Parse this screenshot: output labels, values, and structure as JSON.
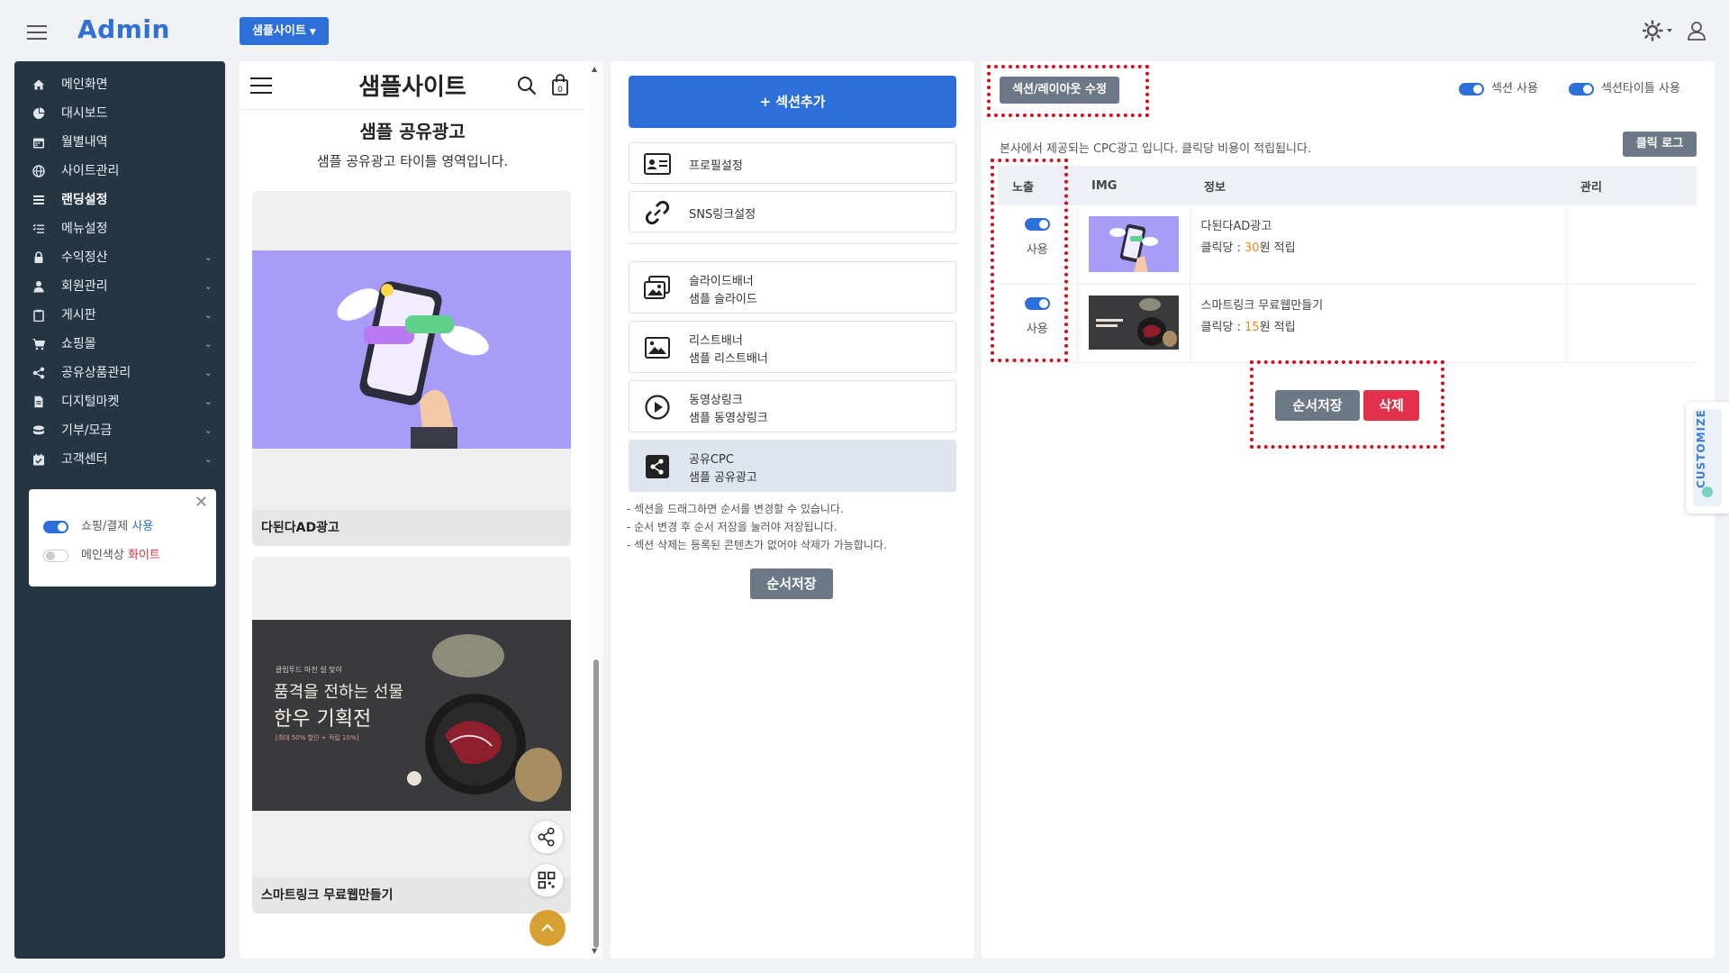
{
  "header": {
    "logo": "Admin",
    "site_dropdown": "샘플사이트",
    "icons": [
      "hamburger-icon",
      "theme-sun-icon",
      "user-icon"
    ]
  },
  "sidebar": {
    "items": [
      {
        "label": "메인화면",
        "icon": "home-icon"
      },
      {
        "label": "대시보드",
        "icon": "pie-chart-icon"
      },
      {
        "label": "월별내역",
        "icon": "calendar-icon"
      },
      {
        "label": "사이트관리",
        "icon": "globe-icon"
      },
      {
        "label": "랜딩설정",
        "icon": "list-icon",
        "active": true
      },
      {
        "label": "메뉴설정",
        "icon": "list-check-icon"
      },
      {
        "label": "수익정산",
        "icon": "lock-icon",
        "expandable": true
      },
      {
        "label": "회원관리",
        "icon": "person-icon",
        "expandable": true
      },
      {
        "label": "게시판",
        "icon": "clipboard-icon",
        "expandable": true
      },
      {
        "label": "쇼핑몰",
        "icon": "cart-icon",
        "expandable": true
      },
      {
        "label": "공유상품관리",
        "icon": "share-icon",
        "expandable": true
      },
      {
        "label": "디지털마켓",
        "icon": "file-icon",
        "expandable": true
      },
      {
        "label": "기부/모금",
        "icon": "coins-icon",
        "expandable": true
      },
      {
        "label": "고객센터",
        "icon": "calendar-check-icon",
        "expandable": true
      }
    ],
    "settings_card": {
      "row1_label": "쇼핑/결제 ",
      "row1_value": "사용",
      "row1_on": true,
      "row2_label": "메인색상 ",
      "row2_value": "화이트",
      "row2_on": false
    }
  },
  "preview": {
    "site_title": "샘플사이트",
    "section_title": "샘플 공유광고",
    "section_subtitle": "샘플 공유광고 타이틀 영역입니다.",
    "cards": [
      {
        "label": "다된다AD광고"
      },
      {
        "label": "스마트링크 무료웹만들기",
        "banner_small": "클립투드 마전 설 맞이",
        "banner_line1": "품격을 전하는 선물",
        "banner_line2": "한우 기획전",
        "banner_tag": "[최대 50% 할인 + 적립 10%]"
      }
    ]
  },
  "sections": {
    "add_button": "+ 섹션추가",
    "items": [
      {
        "line1": "프로필설정",
        "line2": "",
        "icon": "profile-card-icon"
      },
      {
        "line1": "SNS링크설정",
        "line2": "",
        "icon": "link-icon"
      },
      {
        "line1": "슬라이드배너",
        "line2": "샘플 슬라이드",
        "icon": "images-icon"
      },
      {
        "line1": "리스트배너",
        "line2": "샘플 리스트배너",
        "icon": "image-icon"
      },
      {
        "line1": "동영상링크",
        "line2": "샘플 동영상링크",
        "icon": "play-icon"
      },
      {
        "line1": "공유CPC",
        "line2": "샘플 공유광고",
        "icon": "share-square-icon",
        "active": true
      }
    ],
    "notes": [
      "- 섹션을 드래그하면 순서를 변경할 수 있습니다.",
      "- 순서 변경 후 순서 저장을 눌러야 저장됩니다.",
      "- 섹션 삭제는 등록된 콘텐츠가 없어야 삭제가 가능합니다."
    ],
    "save_button": "순서저장"
  },
  "edit": {
    "edit_button": "섹션/레이아웃 수정",
    "switch_section": "섹션 사용",
    "switch_title": "섹션타이틀 사용",
    "description": "본사에서 제공되는 CPC광고 입니다. 클릭당 비용이 적립됩니다.",
    "click_log": "클릭 로그",
    "table": {
      "headers": [
        "노출",
        "IMG",
        "정보",
        "관리"
      ],
      "rows": [
        {
          "use": "사용",
          "title": "다된다AD광고",
          "reward_prefix": "클릭당 : ",
          "reward": "30",
          "reward_suffix": "원 적립"
        },
        {
          "use": "사용",
          "title": "스마트링크 무료웹만들기",
          "reward_prefix": "클릭당 : ",
          "reward": "15",
          "reward_suffix": "원 적립"
        }
      ]
    },
    "order_save": "순서저장",
    "delete": "삭제",
    "annotation_color": "#d0101e"
  },
  "customize_tab": "CUSTOMIZE",
  "colors": {
    "primary": "#2d6fd8",
    "sidebar": "#263544",
    "gray_button": "#6c7886",
    "danger": "#e3304b",
    "accent_orange": "#e8891b"
  }
}
